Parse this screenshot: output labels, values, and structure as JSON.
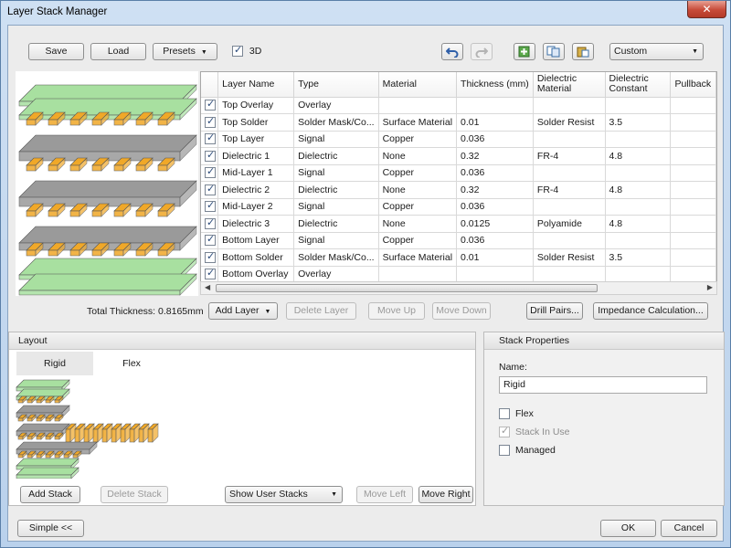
{
  "window": {
    "title": "Layer Stack Manager",
    "close_glyph": "✕"
  },
  "toolbar": {
    "save": "Save",
    "load": "Load",
    "presets": "Presets",
    "three_d_label": "3D",
    "three_d_checked": true,
    "icons": [
      "undo-icon",
      "redo-icon",
      "add-layer-icon",
      "copy-icon",
      "paste-icon"
    ],
    "view_mode": "Custom"
  },
  "table": {
    "headers": [
      "",
      "Layer Name",
      "Type",
      "Material",
      "Thickness (mm)",
      "Dielectric Material",
      "Dielectric Constant",
      "Pullback"
    ],
    "rows": [
      {
        "checked": true,
        "name": "Top Overlay",
        "type": "Overlay",
        "material": "",
        "thickness": "",
        "diel_material": "",
        "diel_constant": ""
      },
      {
        "checked": true,
        "name": "Top Solder",
        "type": "Solder Mask/Co...",
        "material": "Surface Material",
        "thickness": "0.01",
        "diel_material": "Solder Resist",
        "diel_constant": "3.5"
      },
      {
        "checked": true,
        "name": "Top Layer",
        "type": "Signal",
        "material": "Copper",
        "thickness": "0.036",
        "diel_material": "",
        "diel_constant": ""
      },
      {
        "checked": true,
        "name": "Dielectric 1",
        "type": "Dielectric",
        "material": "None",
        "thickness": "0.32",
        "diel_material": "FR-4",
        "diel_constant": "4.8"
      },
      {
        "checked": true,
        "name": "Mid-Layer 1",
        "type": "Signal",
        "material": "Copper",
        "thickness": "0.036",
        "diel_material": "",
        "diel_constant": ""
      },
      {
        "checked": true,
        "name": "Dielectric 2",
        "type": "Dielectric",
        "material": "None",
        "thickness": "0.32",
        "diel_material": "FR-4",
        "diel_constant": "4.8"
      },
      {
        "checked": true,
        "name": "Mid-Layer 2",
        "type": "Signal",
        "material": "Copper",
        "thickness": "0.036",
        "diel_material": "",
        "diel_constant": ""
      },
      {
        "checked": true,
        "name": "Dielectric 3",
        "type": "Dielectric",
        "material": "None",
        "thickness": "0.0125",
        "diel_material": "Polyamide",
        "diel_constant": "4.8"
      },
      {
        "checked": true,
        "name": "Bottom Layer",
        "type": "Signal",
        "material": "Copper",
        "thickness": "0.036",
        "diel_material": "",
        "diel_constant": ""
      },
      {
        "checked": true,
        "name": "Bottom Solder",
        "type": "Solder Mask/Co...",
        "material": "Surface Material",
        "thickness": "0.01",
        "diel_material": "Solder Resist",
        "diel_constant": "3.5"
      },
      {
        "checked": true,
        "name": "Bottom Overlay",
        "type": "Overlay",
        "material": "",
        "thickness": "",
        "diel_material": "",
        "diel_constant": ""
      }
    ]
  },
  "summary": {
    "total_thickness": "Total Thickness: 0.8165mm"
  },
  "actions": {
    "add_layer": "Add Layer",
    "delete_layer": "Delete Layer",
    "move_up": "Move Up",
    "move_down": "Move Down",
    "drill_pairs": "Drill Pairs...",
    "impedance": "Impedance Calculation..."
  },
  "layout_panel": {
    "title": "Layout",
    "tabs": [
      "Rigid",
      "Flex"
    ],
    "active_tab": "Rigid",
    "add_stack": "Add Stack",
    "delete_stack": "Delete Stack",
    "show_stacks": "Show User Stacks",
    "move_left": "Move Left",
    "move_right": "Move Right"
  },
  "stack_properties": {
    "title": "Stack Properties",
    "name_label": "Name:",
    "name_value": "Rigid",
    "flex": {
      "label": "Flex",
      "checked": false
    },
    "stack_in_use": {
      "label": "Stack In Use",
      "checked": true,
      "disabled": true
    },
    "managed": {
      "label": "Managed",
      "checked": false
    }
  },
  "footer": {
    "simple": "Simple <<",
    "ok": "OK",
    "cancel": "Cancel"
  },
  "colors": {
    "overlay": "#a8e0a0",
    "copper": "#f0a828",
    "dielectric": "#9a9a9a",
    "accent": "#3a6ea5"
  }
}
